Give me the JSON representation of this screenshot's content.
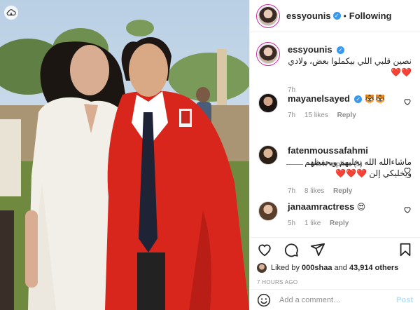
{
  "post": {
    "author": "essyounis",
    "author_verified": true,
    "follow_state": "Following",
    "separator": "•"
  },
  "caption": {
    "username": "essyounis",
    "text": "نصين قلبي اللي بيكملوا بعض، ولادي ❤️❤️",
    "time": "7h"
  },
  "comments": [
    {
      "username": "mayanelsayed",
      "verified": true,
      "text": "🐯🐯",
      "time": "7h",
      "likes": "15 likes",
      "reply": "Reply",
      "view_replies": "View replies (1)"
    },
    {
      "username": "fatenmoussafahmi",
      "verified": false,
      "text": "ماشاءالله الله يخليهم ويحفظهم ويخليكي إلن ❤️❤️❤️",
      "time": "7h",
      "likes": "8 likes",
      "reply": "Reply"
    },
    {
      "username": "janaamractress",
      "verified": false,
      "text": "😍",
      "time": "5h",
      "likes": "1 like",
      "reply": "Reply"
    }
  ],
  "likes": {
    "prefix": "Liked by",
    "first_user": "000shaa",
    "and": "and",
    "others": "43,914 others"
  },
  "timestamp": "7 HOURS AGO",
  "add_comment": {
    "placeholder": "Add a comment…",
    "post_label": "Post"
  },
  "colors": {
    "verified": "#3897f0",
    "post_button": "#b2dffc",
    "gown": "#d9261c",
    "heart": "#ed4956"
  }
}
